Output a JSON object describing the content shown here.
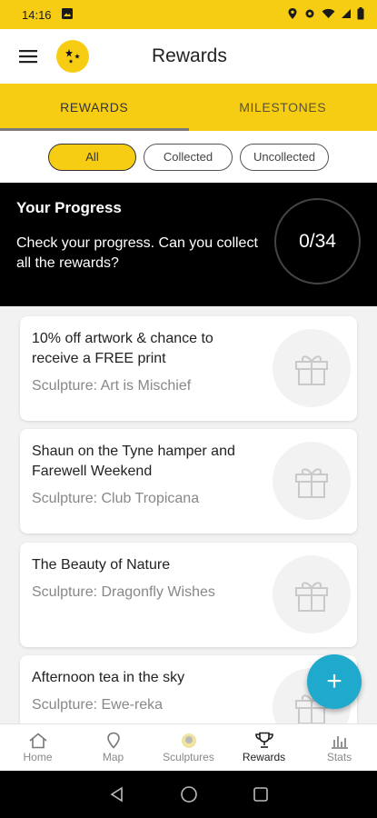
{
  "statusbar": {
    "time": "14:16"
  },
  "appbar": {
    "title": "Rewards"
  },
  "tabs": [
    {
      "label": "REWARDS",
      "active": true
    },
    {
      "label": "MILESTONES",
      "active": false
    }
  ],
  "filters": [
    {
      "label": "All",
      "selected": true
    },
    {
      "label": "Collected",
      "selected": false
    },
    {
      "label": "Uncollected",
      "selected": false
    }
  ],
  "progress": {
    "title": "Your Progress",
    "text": "Check your progress. Can you collect all the rewards?",
    "count": "0/34"
  },
  "rewards": [
    {
      "title": "10% off artwork & chance to receive a FREE print",
      "subtitle": "Sculpture: Art is Mischief",
      "icon": "gift-icon"
    },
    {
      "title": "Shaun on the Tyne hamper and Farewell Weekend",
      "subtitle": "Sculpture: Club Tropicana",
      "icon": "gift-icon"
    },
    {
      "title": "The Beauty of Nature",
      "subtitle": "Sculpture: Dragonfly Wishes",
      "icon": "gift-icon"
    },
    {
      "title": "Afternoon tea in the sky",
      "subtitle": "Sculpture: Ewe-reka",
      "icon": "gift-icon"
    }
  ],
  "fab": {
    "label": "+"
  },
  "bottom_nav": [
    {
      "label": "Home",
      "icon": "home-icon",
      "active": false
    },
    {
      "label": "Map",
      "icon": "map-pin-icon",
      "active": false
    },
    {
      "label": "Sculptures",
      "icon": "sculptures-icon",
      "active": false
    },
    {
      "label": "Rewards",
      "icon": "trophy-icon",
      "active": true
    },
    {
      "label": "Stats",
      "icon": "stats-icon",
      "active": false
    }
  ],
  "colors": {
    "accent": "#f7cd14",
    "fab": "#1fa9cc",
    "progress_bg": "#000000"
  }
}
